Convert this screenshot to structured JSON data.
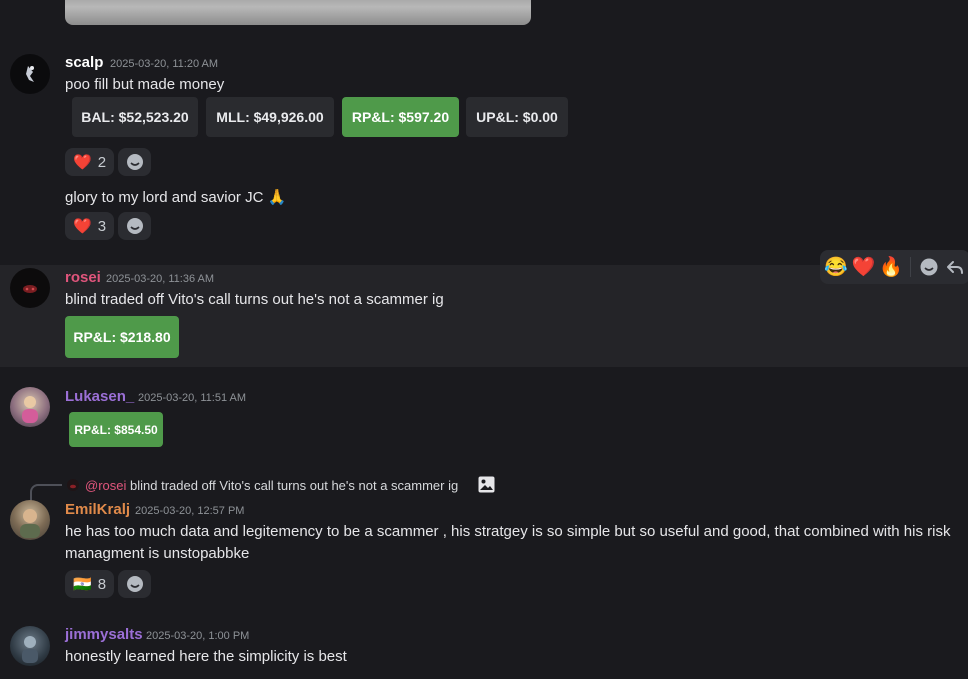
{
  "colors": {
    "background": "#1a1a1e",
    "hover_row": "#242428",
    "green_pill": "#4f9a4a",
    "name_scalp": "#ffffff",
    "name_rosei": "#e0557c",
    "name_lukasen": "#9b6fd6",
    "name_emilkralj": "#e08a4a",
    "name_jimmysalts": "#9b6fd6"
  },
  "messages": {
    "scalp": {
      "username": "scalp",
      "timestamp": "2025-03-20, 11:20 AM",
      "text": "poo fill but made money",
      "pills": [
        "BAL: $52,523.20",
        "MLL: $49,926.00",
        "RP&L: $597.20",
        "UP&L: $0.00"
      ],
      "reaction1": {
        "emoji": "❤️",
        "count": "2"
      },
      "text2": "glory to my lord and savior JC 🙏",
      "reaction2": {
        "emoji": "❤️",
        "count": "3"
      }
    },
    "rosei": {
      "username": "rosei",
      "timestamp": "2025-03-20, 11:36 AM",
      "text": "blind traded off Vito's call turns out he's not a scammer ig",
      "pill": "RP&L: $218.80"
    },
    "lukasen": {
      "username": "Lukasen_",
      "timestamp": "2025-03-20, 11:51 AM",
      "pill": "RP&L: $854.50"
    },
    "emilkralj": {
      "reply_mention": "@rosei",
      "reply_text": "blind traded off Vito's call turns out he's not a scammer ig",
      "username": "EmilKralj",
      "timestamp": "2025-03-20, 12:57 PM",
      "text_line1": "he has too much data and legitemency to be a scammer , his stratgey is so simple but so useful and good, that combined with his risk",
      "text_line2": "managment is unstopabbke",
      "reaction": {
        "emoji": "🇮🇳",
        "count": "8"
      }
    },
    "jimmysalts": {
      "username": "jimmysalts",
      "timestamp": "2025-03-20, 1:00 PM",
      "text": "honestly learned here the simplicity is best"
    }
  },
  "toolbar": {
    "emoji1": "😂",
    "emoji2": "❤️",
    "emoji3": "🔥",
    "icons": [
      "add-reaction-icon",
      "reply-icon"
    ]
  }
}
